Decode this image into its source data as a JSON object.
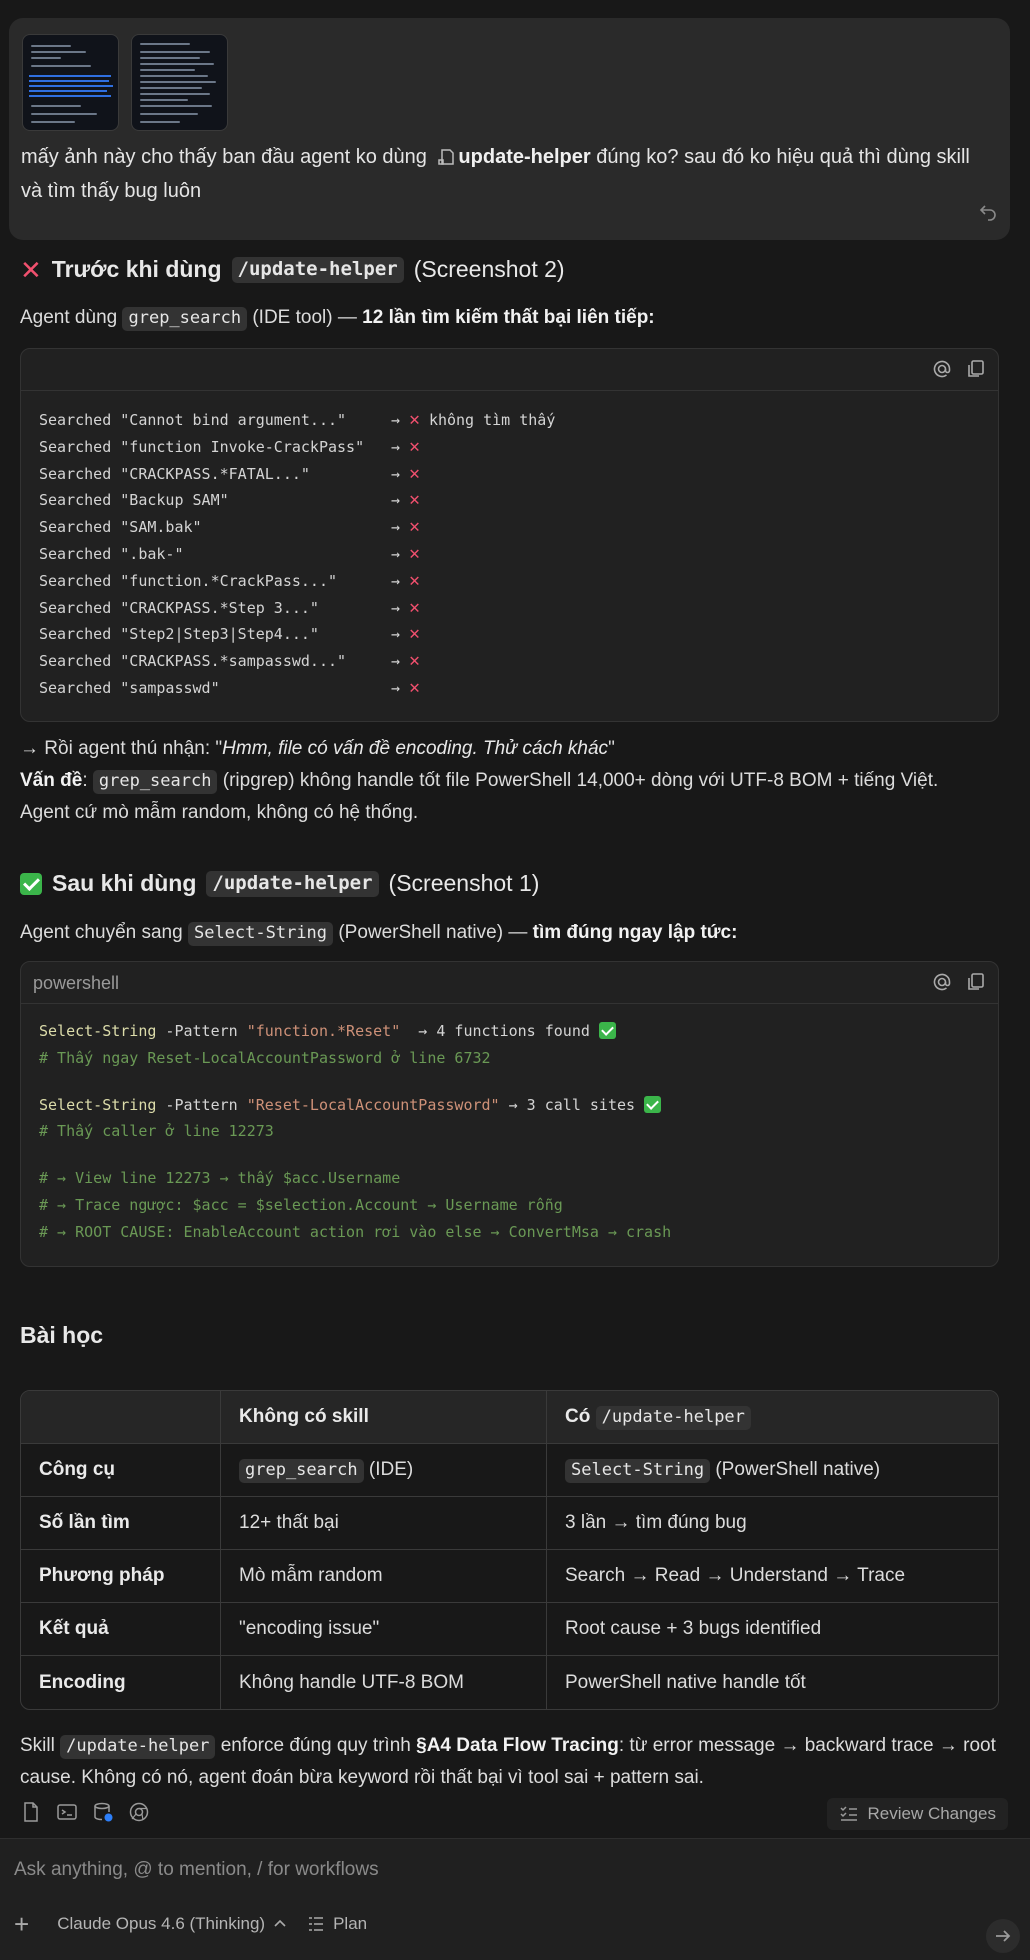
{
  "user_message": {
    "text_before": "mấy ảnh này cho thấy ban đầu agent ko dùng",
    "skill_name": "update-helper",
    "text_after": "đúng ko? sau đó ko hiệu quả thì dùng skill",
    "line2": "và tìm thấy bug luôn"
  },
  "before": {
    "heading_prefix": "Trước khi dùng",
    "heading_code": "/update-helper",
    "heading_suffix": "(Screenshot 2)",
    "intro_a": "Agent dùng",
    "intro_code": "grep_search",
    "intro_b": "(IDE tool) —",
    "intro_bold": "12 lần tìm kiếm thất bại liên tiếp:",
    "rows": [
      {
        "q": "Searched \"Cannot bind argument...\"",
        "note": "không tìm thấy"
      },
      {
        "q": "Searched \"function Invoke-CrackPass\"",
        "note": ""
      },
      {
        "q": "Searched \"CRACKPASS.*FATAL...\"",
        "note": ""
      },
      {
        "q": "Searched \"Backup SAM\"",
        "note": ""
      },
      {
        "q": "Searched \"SAM.bak\"",
        "note": ""
      },
      {
        "q": "Searched \".bak-\"",
        "note": ""
      },
      {
        "q": "Searched \"function.*CrackPass...\"",
        "note": ""
      },
      {
        "q": "Searched \"CRACKPASS.*Step 3...\"",
        "note": ""
      },
      {
        "q": "Searched \"Step2|Step3|Step4...\"",
        "note": ""
      },
      {
        "q": "Searched \"CRACKPASS.*sampasswd...\"",
        "note": ""
      },
      {
        "q": "Searched \"sampasswd\"",
        "note": ""
      }
    ],
    "arrow": "→",
    "admit_prefix": "→ Rồi agent thú nhận: \"",
    "admit_quote": "Hmm, file có vấn đề encoding. Thử cách khác",
    "admit_suffix": "\"",
    "issue_label": "Vấn đề",
    "issue_code": "grep_search",
    "issue_text": "(ripgrep) không handle tốt file PowerShell 14,000+ dòng với UTF-8 BOM + tiếng Việt.",
    "issue_line2": "Agent cứ mò mẫm random, không có hệ thống."
  },
  "after": {
    "heading_prefix": "Sau khi dùng",
    "heading_code": "/update-helper",
    "heading_suffix": "(Screenshot 1)",
    "intro_a": "Agent chuyển sang",
    "intro_code": "Select-String",
    "intro_b": "(PowerShell native) —",
    "intro_bold": "tìm đúng ngay lập tức:",
    "lang": "powershell",
    "code": {
      "l1_cmd": "Select-String",
      "l1_flag": " -Pattern ",
      "l1_str": "\"function.*Reset\"",
      "l1_res": "  → 4 functions found ",
      "l2": "# Thấy ngay Reset-LocalAccountPassword ở line 6732",
      "l3_cmd": "Select-String",
      "l3_flag": " -Pattern ",
      "l3_str": "\"Reset-LocalAccountPassword\"",
      "l3_res": " → 3 call sites ",
      "l4": "# Thấy caller ở line 12273",
      "l5": "# → View line 12273 → thấy $acc.Username",
      "l6": "# → Trace ngược: $acc = $selection.Account → Username rỗng",
      "l7": "# → ROOT CAUSE: EnableAccount action rơi vào else → ConvertMsa → crash"
    }
  },
  "lesson": {
    "title": "Bài học",
    "header": {
      "c1": "",
      "c2": "Không có skill",
      "c3_prefix": "Có",
      "c3_code": "/update-helper"
    },
    "rows": [
      {
        "k": "Công cụ",
        "a_code": "grep_search",
        "a": "(IDE)",
        "b_code": "Select-String",
        "b": "(PowerShell native)"
      },
      {
        "k": "Số lần tìm",
        "a_code": "",
        "a": "12+ thất bại",
        "b_code": "",
        "b": "3 lần → tìm đúng bug"
      },
      {
        "k": "Phương pháp",
        "a_code": "",
        "a": "Mò mẫm random",
        "b_code": "",
        "b": "Search → Read → Understand → Trace"
      },
      {
        "k": "Kết quả",
        "a_code": "",
        "a": "\"encoding issue\"",
        "b_code": "",
        "b": "Root cause + 3 bugs identified"
      },
      {
        "k": "Encoding",
        "a_code": "",
        "a": "Không handle UTF-8 BOM",
        "b_code": "",
        "b": "PowerShell native handle tốt"
      }
    ],
    "summary_a": "Skill",
    "summary_code": "/update-helper",
    "summary_b": "enforce đúng quy trình",
    "summary_bold": "§A4 Data Flow Tracing",
    "summary_c": ": từ error message → backward trace → root",
    "summary_line2": "cause. Không có nó, agent đoán bừa keyword rồi thất bại vì tool sai + pattern sai."
  },
  "toolbar": {
    "review_label": "Review Changes"
  },
  "composer": {
    "placeholder": "Ask anything, @ to mention, / for workflows",
    "model_label": "Claude Opus 4.6 (Thinking)",
    "mode_label": "Plan"
  },
  "colors": {
    "background": "#181818",
    "error": "#f0506e",
    "success": "#3bb54a"
  }
}
